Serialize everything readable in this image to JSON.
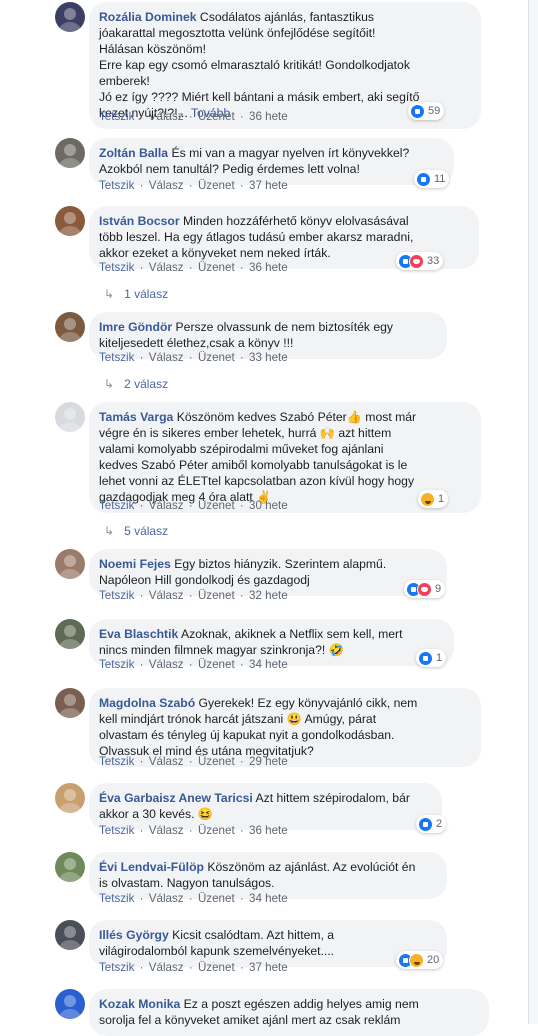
{
  "actions": {
    "like": "Tetszik",
    "reply": "Válasz",
    "message": "Üzenet",
    "sep": "·"
  },
  "comments": [
    {
      "name": "Rozália Dominek",
      "lines": [
        "Csodálatos ajánlás, fantasztikus",
        "jóakarattal megosztotta velünk önfejlődése segítőit!",
        "Hálásan köszönöm!",
        "Erre kap egy csomó elmarasztaló kritikát! Gondolkodjatok",
        "emberek!",
        "Jó ez így ???? Miért kell bántani a másik embert, aki segítő",
        "kezet nyújt?!?!..."
      ],
      "more": "Tovább",
      "time": "36 hete",
      "reactions": [
        "like"
      ],
      "count": "59",
      "avatar_color": "#3b3f63"
    },
    {
      "name": "Zoltán Balla",
      "lines": [
        "És mi van a magyar nyelven írt könyvekkel?",
        "Azokból nem tanultál? Pedig érdemes lett volna!"
      ],
      "time": "37 hete",
      "reactions": [
        "like"
      ],
      "count": "11",
      "avatar_color": "#6d6a66"
    },
    {
      "name": "István Bocsor",
      "lines": [
        "Minden hozzáférhető könyv elolvasásával",
        "több leszel. Ha egy átlagos tudású ember akarsz maradni,",
        "akkor ezeket a könyveket nem neked írták."
      ],
      "time": "36 hete",
      "reactions": [
        "like",
        "heart"
      ],
      "count": "33",
      "avatar_color": "#8a5a3c",
      "replies": "1 válasz"
    },
    {
      "name": "Imre Göndör",
      "lines": [
        "Persze olvassunk de nem biztosíték egy",
        "kiteljesedett élethez,csak a könyv !!!"
      ],
      "time": "33 hete",
      "reactions": [],
      "count": "",
      "avatar_color": "#7b5a40",
      "replies": "2 válasz"
    },
    {
      "name": "Tamás Varga",
      "lines": [
        "Köszönöm kedves Szabó Péter👍 most már",
        "végre én is sikeres ember lehetek, hurrá 🙌 azt hittem",
        "valami komolyabb szépirodalmi műveket fog ajánlani",
        "kedves Szabó Péter amiből komolyabb tanulságokat is le",
        "lehet vonni az ÉLETtel kapcsolatban azon kívül hogy hogy",
        "gazdagodjak meg 4 óra alatt ✌️"
      ],
      "time": "30 hete",
      "reactions": [
        "haha"
      ],
      "count": "1",
      "avatar_color": "#d8dadf",
      "replies": "5 válasz"
    },
    {
      "name": "Noemi Fejes",
      "lines": [
        "Egy biztos hiányzik. Szerintem alapmű.",
        "Napóleon Hill gondolkodj és gazdagodj"
      ],
      "time": "32 hete",
      "reactions": [
        "like",
        "heart"
      ],
      "count": "9",
      "avatar_color": "#9a7b6a"
    },
    {
      "name": "Eva Blaschtik",
      "lines": [
        "Azoknak, akiknek a Netflix sem kell, mert",
        "nincs minden filmnek magyar szinkronja?! 🤣"
      ],
      "time": "34 hete",
      "reactions": [
        "like"
      ],
      "count": "1",
      "avatar_color": "#5f6a55"
    },
    {
      "name": "Magdolna Szabó",
      "lines": [
        "Gyerekek! Ez egy könyvajánló cikk, nem",
        "kell mindjárt trónok harcát játszani 😃 Amúgy, párat",
        "olvastam és tényleg új kapukat nyit a gondolkodásban.",
        "Olvassuk el mind és utána megvitatjuk?"
      ],
      "time": "29 hete",
      "reactions": [],
      "count": "",
      "avatar_color": "#7a5f50"
    },
    {
      "name": "Éva Garbaisz Anew Taricsi",
      "lines": [
        "Azt hittem szépirodalom, bár",
        "akkor a 30 kevés. 😆"
      ],
      "time": "36 hete",
      "reactions": [
        "like"
      ],
      "count": "2",
      "avatar_color": "#c8a070"
    },
    {
      "name": "Évi Lendvai-Fülöp",
      "lines": [
        "Köszönöm az ajánlást. Az evolúciót én",
        "is olvastam. Nagyon tanulságos."
      ],
      "time": "34 hete",
      "reactions": [],
      "count": "",
      "avatar_color": "#6f8a5a"
    },
    {
      "name": "Illés György",
      "lines": [
        "Kicsit csalódtam. Azt hittem, a",
        "világirodalomból kapunk szemelvényeket...."
      ],
      "time": "37 hete",
      "reactions": [
        "like",
        "haha"
      ],
      "count": "20",
      "avatar_color": "#4a4e58"
    },
    {
      "name": "Kozak Monika",
      "lines": [
        "Ez a poszt egészen addig helyes amig nem",
        "sorolja fel a könyveket amiket ajánl mert az csak reklám"
      ],
      "time": "",
      "reactions": [],
      "count": "",
      "avatar_color": "#2a5fd0"
    }
  ]
}
